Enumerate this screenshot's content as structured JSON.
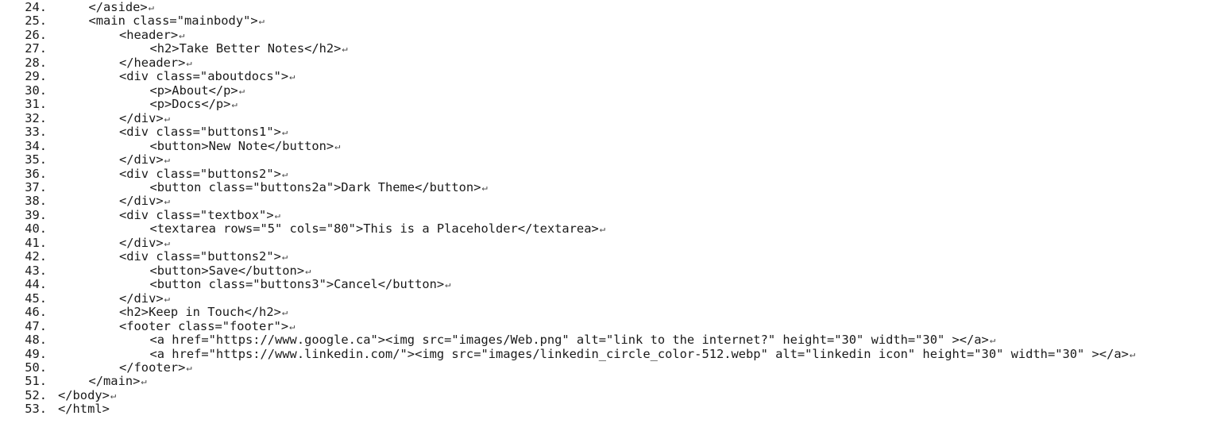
{
  "editor": {
    "return_glyph": "↵",
    "lines": [
      {
        "num": "24.",
        "indent": 1,
        "text": "</aside>",
        "ret": true
      },
      {
        "num": "25.",
        "indent": 1,
        "text": "<main class=\"mainbody\">",
        "ret": true
      },
      {
        "num": "26.",
        "indent": 2,
        "text": "<header>",
        "ret": true
      },
      {
        "num": "27.",
        "indent": 3,
        "text": "<h2>Take Better Notes</h2>",
        "ret": true
      },
      {
        "num": "28.",
        "indent": 2,
        "text": "</header>",
        "ret": true
      },
      {
        "num": "29.",
        "indent": 2,
        "text": "<div class=\"aboutdocs\">",
        "ret": true
      },
      {
        "num": "30.",
        "indent": 3,
        "text": "<p>About</p>",
        "ret": true
      },
      {
        "num": "31.",
        "indent": 3,
        "text": "<p>Docs</p>",
        "ret": true
      },
      {
        "num": "32.",
        "indent": 2,
        "text": "</div>",
        "ret": true
      },
      {
        "num": "33.",
        "indent": 2,
        "text": "<div class=\"buttons1\">",
        "ret": true
      },
      {
        "num": "34.",
        "indent": 3,
        "text": "<button>New Note</button>",
        "ret": true
      },
      {
        "num": "35.",
        "indent": 2,
        "text": "</div>",
        "ret": true
      },
      {
        "num": "36.",
        "indent": 2,
        "text": "<div class=\"buttons2\">",
        "ret": true
      },
      {
        "num": "37.",
        "indent": 3,
        "text": "<button class=\"buttons2a\">Dark Theme</button>",
        "ret": true
      },
      {
        "num": "38.",
        "indent": 2,
        "text": "</div>",
        "ret": true
      },
      {
        "num": "39.",
        "indent": 2,
        "text": "<div class=\"textbox\">",
        "ret": true
      },
      {
        "num": "40.",
        "indent": 3,
        "text": "<textarea rows=\"5\" cols=\"80\">This is a Placeholder</textarea>",
        "ret": true
      },
      {
        "num": "41.",
        "indent": 2,
        "text": "</div>",
        "ret": true
      },
      {
        "num": "42.",
        "indent": 2,
        "text": "<div class=\"buttons2\">",
        "ret": true
      },
      {
        "num": "43.",
        "indent": 3,
        "text": "<button>Save</button>",
        "ret": true
      },
      {
        "num": "44.",
        "indent": 3,
        "text": "<button class=\"buttons3\">Cancel</button>",
        "ret": true
      },
      {
        "num": "45.",
        "indent": 2,
        "text": "</div>",
        "ret": true
      },
      {
        "num": "46.",
        "indent": 2,
        "text": "<h2>Keep in Touch</h2>",
        "ret": true
      },
      {
        "num": "47.",
        "indent": 2,
        "text": "<footer class=\"footer\">",
        "ret": true
      },
      {
        "num": "48.",
        "indent": 3,
        "text": "<a href=\"https://www.google.ca\"><img src=\"images/Web.png\" alt=\"link to the internet?\" height=\"30\" width=\"30\" ></a>",
        "ret": true
      },
      {
        "num": "49.",
        "indent": 3,
        "text": "<a href=\"https://www.linkedin.com/\"><img src=\"images/linkedin_circle_color-512.webp\" alt=\"linkedin icon\" height=\"30\" width=\"30\" ></a>",
        "ret": true
      },
      {
        "num": "50.",
        "indent": 2,
        "text": "</footer>",
        "ret": true
      },
      {
        "num": "51.",
        "indent": 1,
        "text": "</main>",
        "ret": true
      },
      {
        "num": "52.",
        "indent": 0,
        "text": "</body>",
        "ret": true
      },
      {
        "num": "53.",
        "indent": 0,
        "text": "</html>",
        "ret": false
      }
    ]
  }
}
